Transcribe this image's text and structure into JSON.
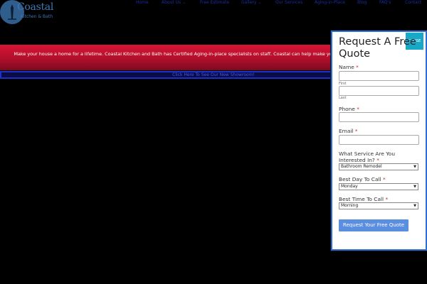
{
  "logo": {
    "title": "Coastal",
    "subtitle": "Kitchen & Bath"
  },
  "nav": {
    "items": [
      {
        "label": "Home"
      },
      {
        "label": "About Us",
        "dropdown": true
      },
      {
        "label": "Free Estimate"
      },
      {
        "label": "Gallery",
        "dropdown": true
      },
      {
        "label": "Our Services"
      },
      {
        "label": "Aging-in-Place"
      },
      {
        "label": "Blog"
      },
      {
        "label": "FAQ's"
      },
      {
        "label": "Contact"
      }
    ]
  },
  "banner": {
    "text": "Make your house a home for a lifetime. Coastal Kitchen and Bath has Certified Aging-in-place specialists on staff. Coastal can help make your home comfortable and beautiful."
  },
  "showroom": {
    "label": "Click Here To See Our New Showroom!"
  },
  "modal": {
    "close_label": "CLOSE",
    "title": "Request A Free Quote",
    "name_label": "Name",
    "first_label": "First",
    "last_label": "Last",
    "phone_label": "Phone",
    "email_label": "Email",
    "service_label": "What Service Are You Interested In?",
    "service_value": "Bathroom Remodel",
    "day_label": "Best Day To Call",
    "day_value": "Monday",
    "time_label": "Best Time To Call",
    "time_value": "Morning",
    "required_mark": "*",
    "submit_label": "Request Your Free Quote"
  },
  "colors": {
    "banner_red": "#c8102e",
    "showroom_link": "#3f5bff",
    "close_button": "#18a9c9",
    "submit_button": "#5a8ee0",
    "required": "#c0281d"
  }
}
